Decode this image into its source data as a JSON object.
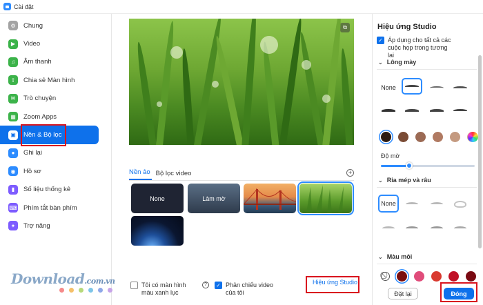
{
  "window": {
    "title": "Cài đặt"
  },
  "sidebar": {
    "items": [
      {
        "label": "Chung",
        "icon": "gear-icon",
        "color": "#a3a3a3"
      },
      {
        "label": "Video",
        "icon": "video-camera-icon",
        "color": "#3cb34a"
      },
      {
        "label": "Âm thanh",
        "icon": "headphones-icon",
        "color": "#3cb34a"
      },
      {
        "label": "Chia sẻ Màn hình",
        "icon": "share-screen-icon",
        "color": "#3cb34a"
      },
      {
        "label": "Trò chuyện",
        "icon": "chat-icon",
        "color": "#3cb34a"
      },
      {
        "label": "Zoom Apps",
        "icon": "apps-icon",
        "color": "#3cb34a"
      },
      {
        "label": "Nền & Bộ lọc",
        "icon": "background-icon",
        "color": "#0e71eb",
        "active": true
      },
      {
        "label": "Ghi lại",
        "icon": "record-icon",
        "color": "#2d8cff"
      },
      {
        "label": "Hồ sơ",
        "icon": "profile-icon",
        "color": "#2d8cff"
      },
      {
        "label": "Số liệu thống kê",
        "icon": "stats-icon",
        "color": "#7d5cff"
      },
      {
        "label": "Phím tắt bàn phím",
        "icon": "keyboard-icon",
        "color": "#7d5cff"
      },
      {
        "label": "Trợ năng",
        "icon": "accessibility-icon",
        "color": "#7d5cff"
      }
    ]
  },
  "main": {
    "tabs": [
      {
        "label": "Nền ảo",
        "active": true
      },
      {
        "label": "Bộ lọc video",
        "active": false
      }
    ],
    "backgrounds": [
      {
        "label": "None",
        "kind": "none"
      },
      {
        "label": "Làm mờ",
        "kind": "blur"
      },
      {
        "label": "",
        "kind": "bridge"
      },
      {
        "label": "",
        "kind": "grass",
        "selected": true
      },
      {
        "label": "",
        "kind": "earth"
      }
    ],
    "green_screen_label": "Tôi có màn hình màu xanh lục",
    "green_screen_checked": false,
    "mirror_label": "Phản chiếu video của tôi",
    "mirror_checked": true,
    "studio_link": "Hiệu ứng Studio"
  },
  "studio": {
    "title": "Hiệu ứng Studio",
    "apply_all_label": "Áp dụng cho tất cả các cuộc họp trong tương lai",
    "apply_all_checked": true,
    "eyebrows_label": "Lông mày",
    "eyebrow_none": "None",
    "brow_colors": [
      "#2b1a12",
      "#7a4b35",
      "#9b6a54",
      "#b07a62",
      "#c49a80",
      "#ccaa8c"
    ],
    "opacity_label": "Độ mờ",
    "opacity_value": 0.3,
    "mustache_label": "Ria mép và râu",
    "mustache_none": "None",
    "lip_label": "Màu môi",
    "lip_colors": [
      "#7a0e0e",
      "#e04c7a",
      "#d93a30",
      "#c01026",
      "#7a0a12"
    ],
    "reset_label": "Đặt lại",
    "close_label": "Đóng"
  },
  "watermark": {
    "text": "Download",
    "tld": ".com.vn",
    "dot_colors": [
      "#f58a8a",
      "#f5c06a",
      "#b6d97a",
      "#7ec5e8",
      "#8fa8e8",
      "#c7a4e8"
    ]
  }
}
